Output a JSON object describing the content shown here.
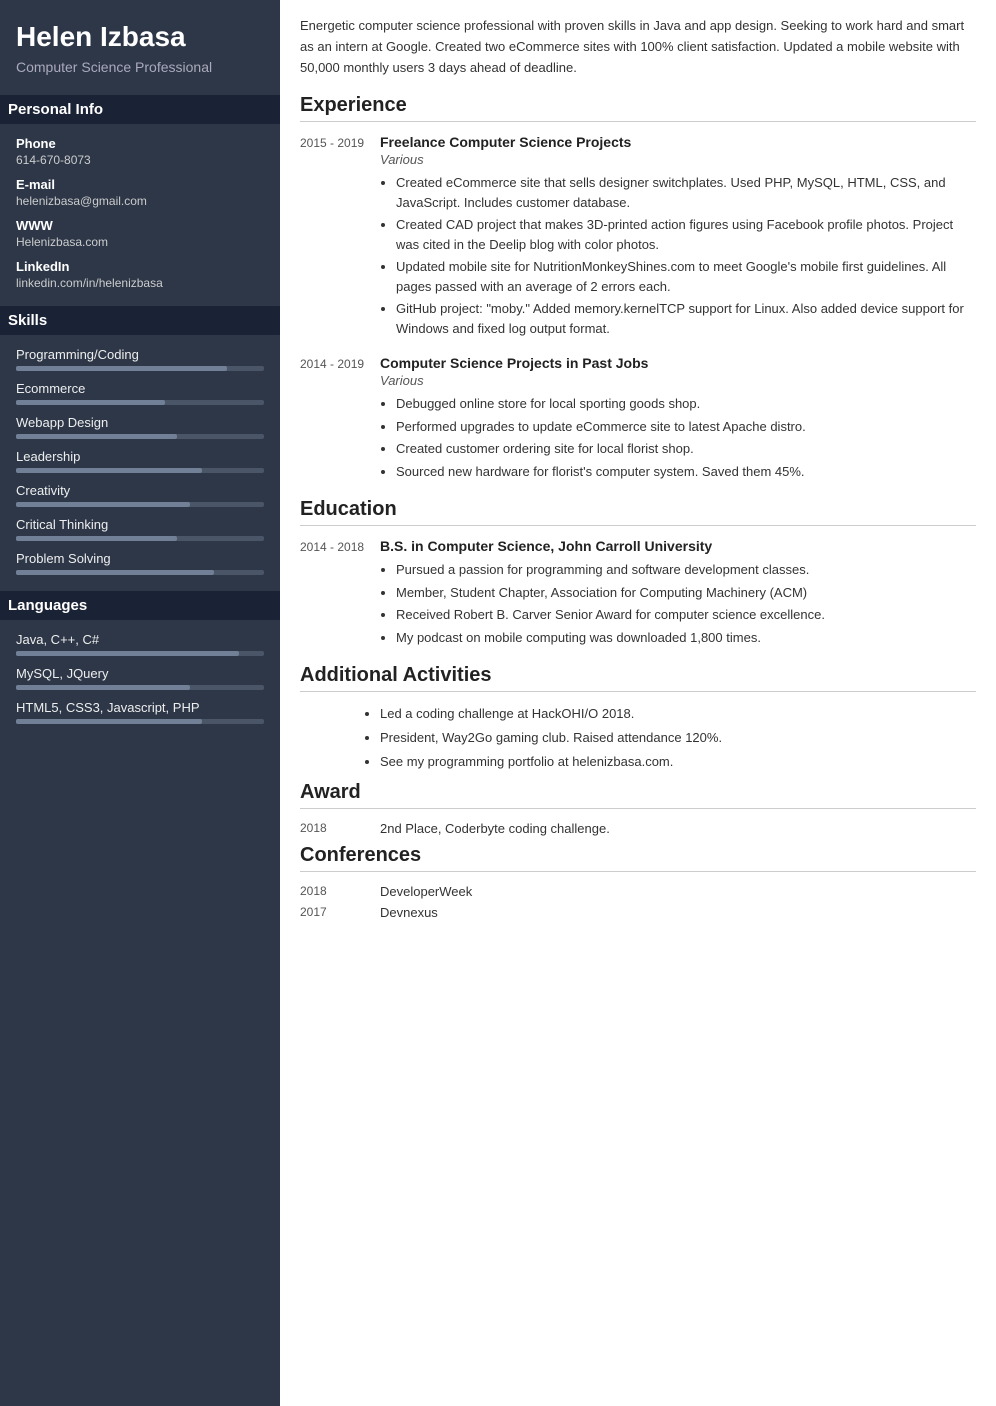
{
  "sidebar": {
    "name": "Helen Izbasa",
    "title": "Computer Science Professional",
    "personal_info_label": "Personal Info",
    "phone_label": "Phone",
    "phone": "614-670-8073",
    "email_label": "E-mail",
    "email": "helenizbasa@gmail.com",
    "www_label": "WWW",
    "www": "Helenizbasa.com",
    "linkedin_label": "LinkedIn",
    "linkedin": "linkedin.com/in/helenizbasa",
    "skills_label": "Skills",
    "skills": [
      {
        "name": "Programming/Coding",
        "pct": 85
      },
      {
        "name": "Ecommerce",
        "pct": 60
      },
      {
        "name": "Webapp Design",
        "pct": 65
      },
      {
        "name": "Leadership",
        "pct": 75
      },
      {
        "name": "Creativity",
        "pct": 70
      },
      {
        "name": "Critical Thinking",
        "pct": 65
      },
      {
        "name": "Problem Solving",
        "pct": 80
      }
    ],
    "languages_label": "Languages",
    "languages": [
      {
        "name": "Java, C++, C#",
        "pct": 90
      },
      {
        "name": "MySQL, JQuery",
        "pct": 70
      },
      {
        "name": "HTML5, CSS3, Javascript, PHP",
        "pct": 75
      }
    ]
  },
  "main": {
    "summary": "Energetic computer science professional with proven skills in Java and app design. Seeking to work hard and smart as an intern at Google. Created two eCommerce sites with 100% client satisfaction. Updated a mobile website with 50,000 monthly users 3 days ahead of deadline.",
    "experience_label": "Experience",
    "experiences": [
      {
        "dates": "2015 - 2019",
        "title": "Freelance Computer Science Projects",
        "company": "Various",
        "bullets": [
          "Created eCommerce site that sells designer switchplates. Used PHP, MySQL, HTML, CSS, and JavaScript. Includes customer database.",
          "Created CAD project that makes 3D-printed action figures using Facebook profile photos. Project was cited in the Deelip blog with color photos.",
          "Updated mobile site for NutritionMonkeyShines.com to meet Google's mobile first guidelines. All pages passed with an average of 2 errors each.",
          "GitHub project: \"moby.\" Added memory.kernelTCP support for Linux. Also added device support for Windows and fixed log output format."
        ]
      },
      {
        "dates": "2014 - 2019",
        "title": "Computer Science Projects in Past Jobs",
        "company": "Various",
        "bullets": [
          "Debugged online store for local sporting goods shop.",
          "Performed upgrades to update eCommerce site to latest Apache distro.",
          "Created customer ordering site for local florist shop.",
          "Sourced new hardware for florist's computer system. Saved them 45%."
        ]
      }
    ],
    "education_label": "Education",
    "educations": [
      {
        "dates": "2014 - 2018",
        "degree": "B.S. in Computer Science, John Carroll University",
        "bullets": [
          "Pursued a passion for programming and software development classes.",
          "Member, Student Chapter, Association for Computing Machinery (ACM)",
          "Received Robert B. Carver Senior Award for computer science excellence.",
          "My podcast on mobile computing was downloaded 1,800 times."
        ]
      }
    ],
    "activities_label": "Additional Activities",
    "activities": [
      "Led a coding challenge at HackOHI/O 2018.",
      "President, Way2Go gaming club. Raised attendance 120%.",
      "See my programming portfolio at helenizbasa.com."
    ],
    "award_label": "Award",
    "awards": [
      {
        "year": "2018",
        "text": "2nd Place, Coderbyte coding challenge."
      }
    ],
    "conferences_label": "Conferences",
    "conferences": [
      {
        "year": "2018",
        "name": "DeveloperWeek"
      },
      {
        "year": "2017",
        "name": "Devnexus"
      }
    ]
  }
}
